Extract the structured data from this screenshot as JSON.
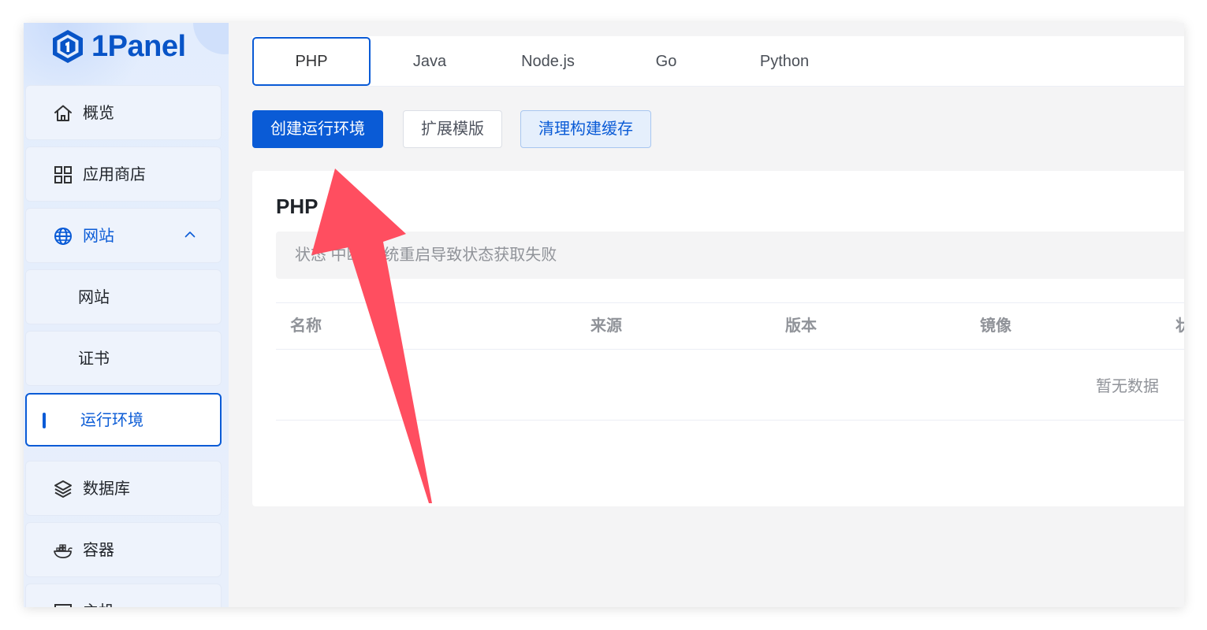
{
  "app": {
    "logo_text": "1Panel"
  },
  "sidebar": {
    "items": [
      {
        "label": "概览",
        "icon": "home-icon"
      },
      {
        "label": "应用商店",
        "icon": "grid-icon"
      },
      {
        "label": "网站",
        "icon": "globe-icon",
        "expanded": true
      },
      {
        "label": "网站",
        "sub": true
      },
      {
        "label": "证书",
        "sub": true
      },
      {
        "label": "运行环境",
        "sub": true,
        "active": true
      },
      {
        "label": "数据库",
        "icon": "layers-icon"
      },
      {
        "label": "容器",
        "icon": "docker-icon"
      },
      {
        "label": "主机",
        "icon": "monitor-icon"
      }
    ]
  },
  "tabs": [
    {
      "label": "PHP",
      "active": true
    },
    {
      "label": "Java"
    },
    {
      "label": "Node.js"
    },
    {
      "label": "Go"
    },
    {
      "label": "Python"
    }
  ],
  "toolbar": {
    "create_label": "创建运行环境",
    "extend_label": "扩展模版",
    "clean_label": "清理构建缓存"
  },
  "card": {
    "title": "PHP",
    "notice": "状态 中断-系统重启导致状态获取失败",
    "columns": [
      "名称",
      "来源",
      "版本",
      "镜像",
      "状"
    ],
    "empty_text": "暂无数据"
  },
  "colors": {
    "primary": "#0a5bd6",
    "arrow": "#ff4e60",
    "sidebar_bg": "#e3edfd"
  }
}
